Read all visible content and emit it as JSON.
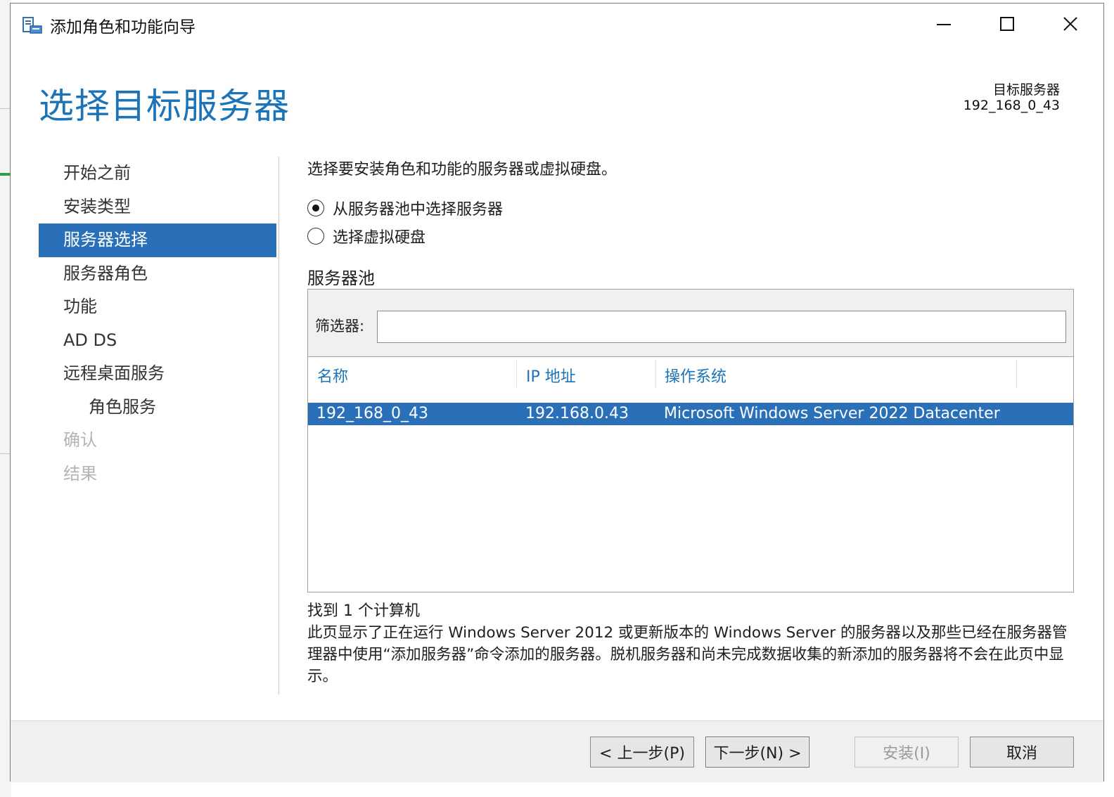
{
  "window": {
    "title": "添加角色和功能向导",
    "controls": {
      "minimize": "minimize-icon",
      "maximize": "maximize-icon",
      "close": "close-icon"
    }
  },
  "header": {
    "page_title": "选择目标服务器",
    "target_label": "目标服务器",
    "target_value": "192_168_0_43"
  },
  "nav": {
    "items": [
      {
        "label": "开始之前",
        "state": "normal"
      },
      {
        "label": "安装类型",
        "state": "normal"
      },
      {
        "label": "服务器选择",
        "state": "active"
      },
      {
        "label": "服务器角色",
        "state": "normal"
      },
      {
        "label": "功能",
        "state": "normal"
      },
      {
        "label": "AD DS",
        "state": "normal"
      },
      {
        "label": "远程桌面服务",
        "state": "normal"
      },
      {
        "label": "角色服务",
        "state": "sub"
      },
      {
        "label": "确认",
        "state": "disabled"
      },
      {
        "label": "结果",
        "state": "disabled"
      }
    ]
  },
  "content": {
    "intro": "选择要安装角色和功能的服务器或虚拟硬盘。",
    "options": [
      {
        "label": "从服务器池中选择服务器",
        "checked": true
      },
      {
        "label": "选择虚拟硬盘",
        "checked": false
      }
    ],
    "pool_label": "服务器池",
    "filter_label": "筛选器:",
    "filter_value": "",
    "columns": [
      "名称",
      "IP 地址",
      "操作系统"
    ],
    "rows": [
      {
        "name": "192_168_0_43",
        "ip": "192.168.0.43",
        "os": "Microsoft Windows Server 2022 Datacenter",
        "selected": true
      }
    ],
    "found_text": "找到 1 个计算机",
    "description": "此页显示了正在运行 Windows Server 2012 或更新版本的 Windows Server 的服务器以及那些已经在服务器管理器中使用“添加服务器”命令添加的服务器。脱机服务器和尚未完成数据收集的新添加的服务器将不会在此页中显示。"
  },
  "footer": {
    "prev": "< 上一步(P)",
    "next": "下一步(N) >",
    "install": "安装(I)",
    "cancel": "取消"
  },
  "colors": {
    "accent": "#1c74b8",
    "selection": "#2a70b9",
    "disabled_text": "#b4b4b4"
  }
}
